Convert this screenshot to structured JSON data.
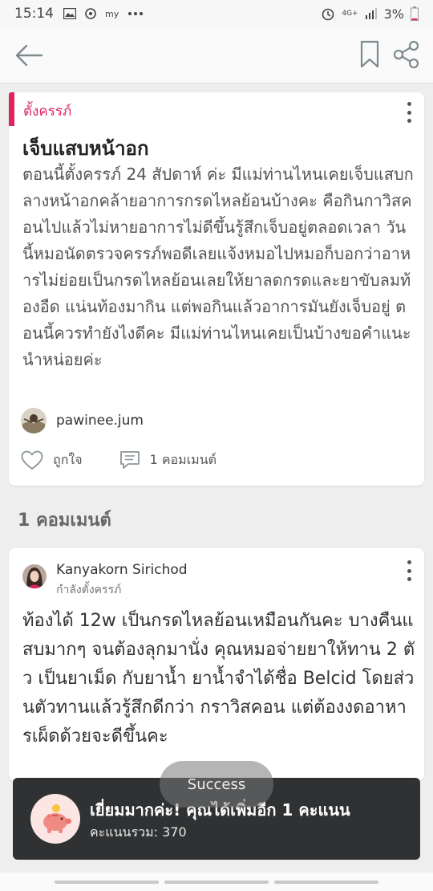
{
  "status_bar": {
    "time": "15:14",
    "signal_label": "4G+",
    "battery": "3%"
  },
  "app_bar": {
    "back_icon": "arrow-left-icon",
    "bookmark_icon": "bookmark-icon",
    "share_icon": "share-icon"
  },
  "post": {
    "category": "ตั้งครรภ์",
    "title": "เจ็บแสบหน้าอก",
    "body": "ตอนนี้ตั้งครรภ์ 24 สัปดาห์ ค่ะ มีแม่ท่านไหนเคยเจ็บแสบกลางหน้าอกคล้ายอาการกรดไหลย้อนบ้างคะ คือกินกาวิสคอนไปแล้วไม่หายอาการไม่ดีขึ้นรู้สึกเจ็บอยู่ตลอดเวลา วันนี้หมอนัดตรวจครรภ์พอดีเลยแจ้งหมอไปหมอก็บอกว่าอาหารไม่ย่อยเป็นกรดไหลย้อนเลยให้ยาลดกรดและยาขับลมท้องอืด แน่นท้องมากิน แต่พอกินแล้วอาการมันยังเจ็บอยู่ ตอนนี้ควรทำยังไงดีคะ มีแม่ท่านไหนเคยเป็นบ้างขอคำแนะนำหน่อยค่ะ",
    "author": "pawinee.jum",
    "like_label": "ถูกใจ",
    "comment_count_label": "1 คอมเมนต์"
  },
  "comments_section": {
    "title": "1 คอมเมนต์"
  },
  "comment": {
    "author": "Kanyakorn Sirichod",
    "status": "กำลังตั้งครรภ์",
    "body": "ท้องได้ 12w เป็นกรดไหลย้อนเหมือนกันคะ บางคืนแสบมากๆ จนต้องลุกมานั่ง คุณหมอจ่ายยาให้ทาน 2 ตัว เป็นยาเม็ด กับยาน้ำ ยาน้ำจำได้ชื่อ Belcid โดยส่วนตัวทานแล้วรู้สึกดีกว่า กราวิสคอน  แต่ต้องงดอาหารเผ็ดด้วยจะดีขึ้นคะ"
  },
  "toast": {
    "text": "Success"
  },
  "reward": {
    "title": "เยี่ยมมากค่ะ! คุณได้เพิ่มอีก 1 คะแนน",
    "score": "คะแนนรวม: 370",
    "icon": "piggy-bank-icon"
  },
  "colors": {
    "accent": "#e0245e",
    "snackbar": "#2f3133"
  }
}
